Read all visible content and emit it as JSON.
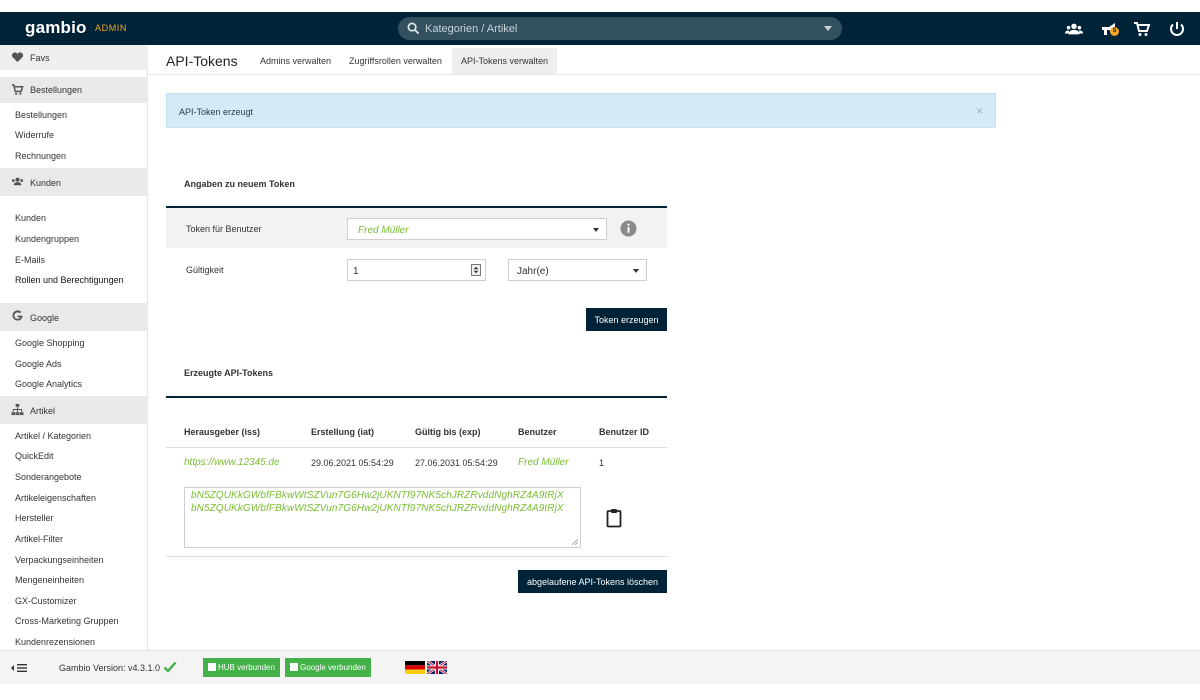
{
  "topbar": {
    "logo": "gambio",
    "admin_tag": "ADMIN",
    "search_placeholder": "Kategorien / Artikel",
    "notification_count": "5"
  },
  "sidebar": {
    "favs": "Favs",
    "bestellungen_head": "Bestellungen",
    "bestellungen_items": [
      "Bestellungen",
      "Widerrufe",
      "Rechnungen"
    ],
    "kunden_head": "Kunden",
    "kunden_items": [
      "Kunden",
      "Kundengruppen",
      "E-Mails",
      "Rollen und Berechtigungen"
    ],
    "google_head": "Google",
    "google_items": [
      "Google Shopping",
      "Google Ads",
      "Google Analytics"
    ],
    "artikel_head": "Artikel",
    "artikel_items": [
      "Artikel / Kategorien",
      "QuickEdit",
      "Sonderangebote",
      "Artikeleigenschaften",
      "Hersteller",
      "Artikel-Filter",
      "Verpackungseinheiten",
      "Mengeneinheiten",
      "GX-Customizer",
      "Cross-Marketing Gruppen",
      "Kundenrezensionen"
    ]
  },
  "header": {
    "title": "API-Tokens",
    "tabs": [
      "Admins verwalten",
      "Zugriffsrollen verwalten",
      "API-Tokens verwalten"
    ]
  },
  "alert": {
    "message": "API-Token erzeugt",
    "close": "×"
  },
  "new_token": {
    "heading": "Angaben zu neuem Token",
    "user_label": "Token für Benutzer",
    "user_value": "Fred Müller",
    "validity_label": "Gültigkeit",
    "validity_value": "1",
    "unit_value": "Jahr(e)",
    "create_button": "Token erzeugen"
  },
  "tokens": {
    "heading": "Erzeugte API-Tokens",
    "columns": [
      "Herausgeber (iss)",
      "Erstellung (iat)",
      "Gültig bis (exp)",
      "Benutzer",
      "Benutzer ID"
    ],
    "rows": [
      {
        "issuer": "https://www.12345.de",
        "created": "29.06.2021 05:54:29",
        "valid_until": "27.06.2031 05:54:29",
        "user": "Fred Müller",
        "user_id": "1",
        "token_line1": "bN5ZQUKkGWbfFBkwWtSZVun7G6Hw2jUKNTf97NK5chJRZRvddNghRZ4A9tRjX",
        "token_line2": "bN5ZQUKkGWbfFBkwWtSZVun7G6Hw2jUKNTf97NK5chJRZRvddNghRZ4A9tRjX"
      }
    ],
    "delete_button": "abgelaufene API-Tokens löschen"
  },
  "footer": {
    "version": "Gambio Version: v4.3.1.0",
    "hub": "HUB verbunden",
    "google": "Google verbunden"
  },
  "colors": {
    "navy": "#002337",
    "green": "#7bbd34",
    "footer_green": "#45b149",
    "accent": "#f3a625"
  }
}
